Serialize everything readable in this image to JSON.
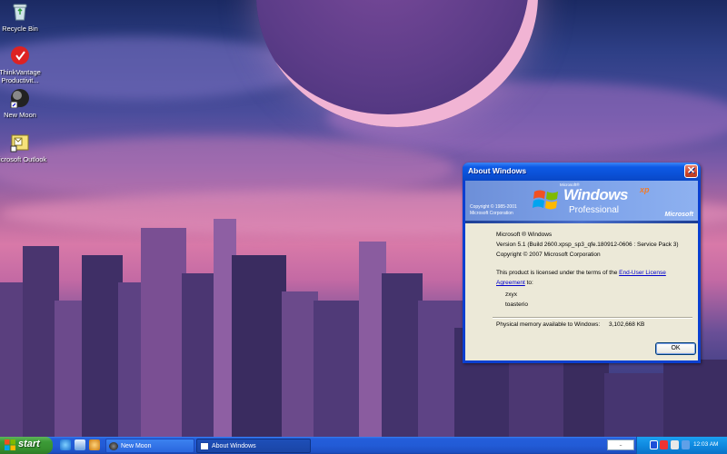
{
  "desktop": {
    "icons": [
      {
        "label": "Recycle Bin",
        "icon": "recycle-bin-icon"
      },
      {
        "label": "ThinkVantage Productivit...",
        "icon": "thinkvantage-icon"
      },
      {
        "label": "New Moon",
        "icon": "new-moon-browser-icon"
      },
      {
        "label": "Microsoft Outlook",
        "icon": "outlook-icon"
      }
    ]
  },
  "dialog": {
    "title": "About Windows",
    "close_icon": "close-icon",
    "banner": {
      "copyright_line1": "Copyright © 1985-2001",
      "copyright_line2": "Microsoft Corporation",
      "microsoft_small": "Microsoft®",
      "windows": "Windows",
      "xp": "xp",
      "edition": "Professional",
      "ms_logo": "Microsoft"
    },
    "product": "Microsoft ® Windows",
    "version": "Version 5.1 (Build 2600.xpsp_sp3_qfe.180912-0606 : Service Pack 3)",
    "copyright": "Copyright © 2007 Microsoft Corporation",
    "license_prefix": "This product is licensed under the terms of the",
    "license_link": "End-User License Agreement",
    "license_suffix": "to:",
    "licensee_name": "zxyx",
    "licensee_org": "toasterio",
    "memory_label": "Physical memory available to Windows:",
    "memory_value": "3,102,668 KB",
    "ok_label": "OK"
  },
  "taskbar": {
    "start_label": "start",
    "quick_launch": [
      "ie-icon",
      "desktop-icon",
      "media-icon"
    ],
    "tasks": [
      {
        "label": "New Moon",
        "active": false
      },
      {
        "label": "About Windows",
        "active": true
      }
    ],
    "search_text": "..",
    "clock": "12:03 AM"
  },
  "colors": {
    "title_blue": "#0a4fd4",
    "start_green": "#3c9a37",
    "tray_blue": "#0f8ae0",
    "dialog_face": "#ece9d8"
  }
}
